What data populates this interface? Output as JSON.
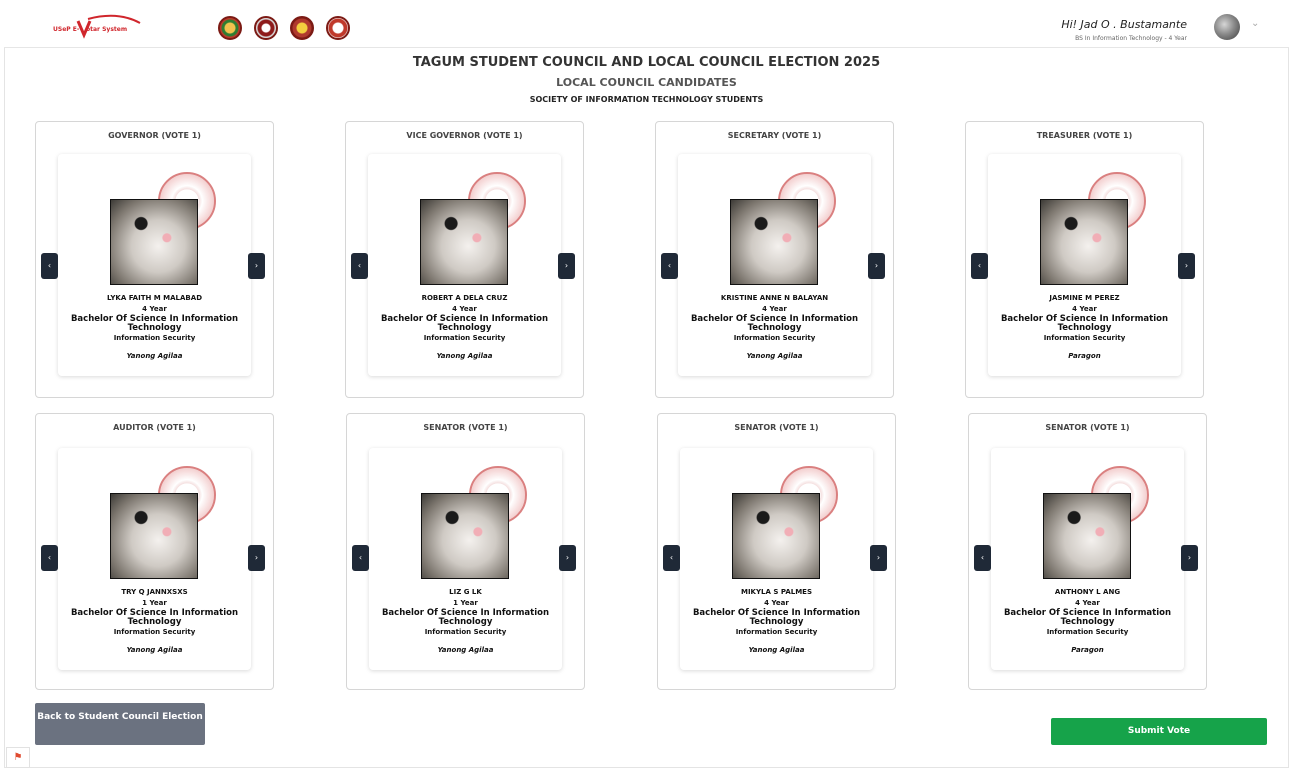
{
  "app": {
    "logo_text_1": "USeP E-",
    "logo_text_2": "otar System"
  },
  "user": {
    "greeting": "Hi! Jad O . Bustamante",
    "program": "BS In Information Technology - 4 Year"
  },
  "titles": {
    "election": "TAGUM STUDENT COUNCIL AND LOCAL COUNCIL ELECTION 2025",
    "section": "LOCAL COUNCIL CANDIDATES",
    "org": "SOCIETY OF INFORMATION TECHNOLOGY STUDENTS"
  },
  "positions": [
    {
      "title": "GOVERNOR (VOTE 1)",
      "name": "LYKA FAITH M MALABAD",
      "year": "4 Year",
      "course": "Bachelor Of Science In Information Technology",
      "major": "Information Security",
      "party": "Yanong Agilaa"
    },
    {
      "title": "VICE GOVERNOR (VOTE 1)",
      "name": "ROBERT A DELA CRUZ",
      "year": "4 Year",
      "course": "Bachelor Of Science In Information Technology",
      "major": "Information Security",
      "party": "Yanong Agilaa"
    },
    {
      "title": "SECRETARY (VOTE 1)",
      "name": "KRISTINE ANNE N BALAYAN",
      "year": "4 Year",
      "course": "Bachelor Of Science In Information Technology",
      "major": "Information Security",
      "party": "Yanong Agilaa"
    },
    {
      "title": "TREASURER (VOTE 1)",
      "name": "JASMINE M PEREZ",
      "year": "4 Year",
      "course": "Bachelor Of Science In Information Technology",
      "major": "Information Security",
      "party": "Paragon"
    },
    {
      "title": "AUDITOR (VOTE 1)",
      "name": "TRY Q JANNXSXS",
      "year": "1 Year",
      "course": "Bachelor Of Science In Information Technology",
      "major": "Information Security",
      "party": "Yanong Agilaa"
    },
    {
      "title": "SENATOR (VOTE 1)",
      "name": "LIZ G LK",
      "year": "1 Year",
      "course": "Bachelor Of Science In Information Technology",
      "major": "Information Security",
      "party": "Yanong Agilaa"
    },
    {
      "title": "SENATOR (VOTE 1)",
      "name": "MIKYLA S PALMES",
      "year": "4 Year",
      "course": "Bachelor Of Science In Information Technology",
      "major": "Information Security",
      "party": "Yanong Agilaa"
    },
    {
      "title": "SENATOR (VOTE 1)",
      "name": "ANTHONY L ANG",
      "year": "4 Year",
      "course": "Bachelor Of Science In Information Technology",
      "major": "Information Security",
      "party": "Paragon"
    }
  ],
  "buttons": {
    "back": "Back to Student Council Election",
    "submit": "Submit Vote",
    "prev_glyph": "‹",
    "next_glyph": "›",
    "chevron_glyph": "⌄",
    "corner_glyph": "⚑"
  },
  "colors": {
    "brand": "#d0262c",
    "submit": "#16a34a",
    "back": "#6b7280",
    "arrow": "#1f2937"
  }
}
